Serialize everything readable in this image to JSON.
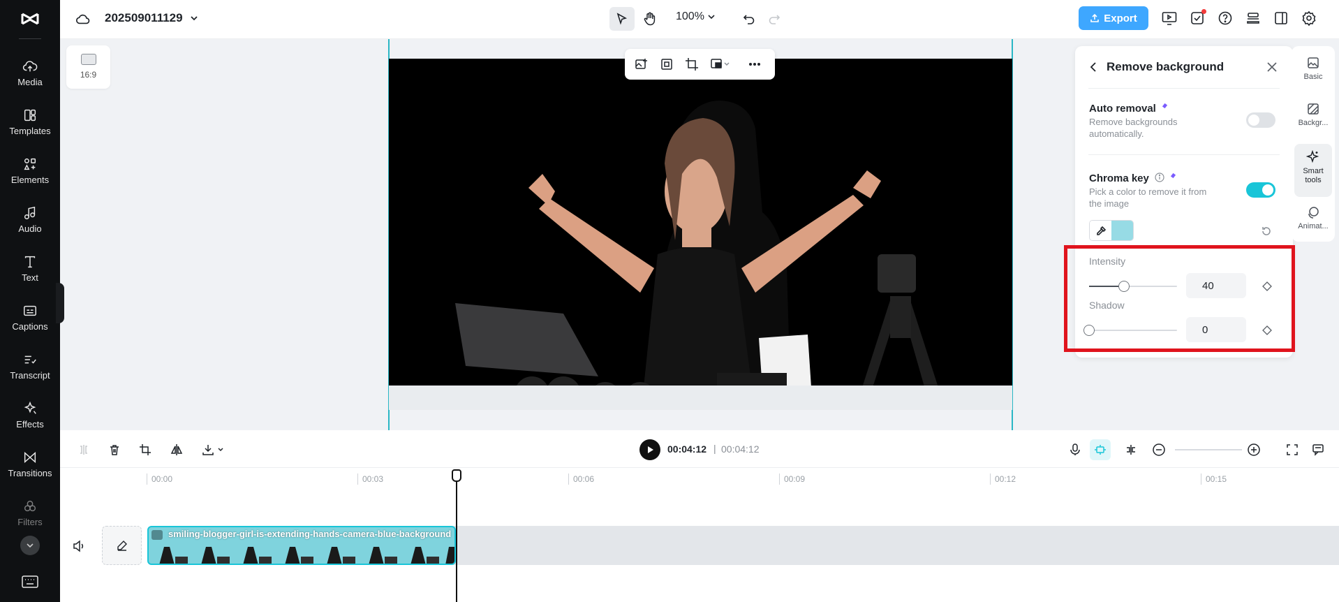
{
  "sidebar": {
    "items": [
      {
        "label": "Media",
        "icon": "upload-cloud-icon"
      },
      {
        "label": "Templates",
        "icon": "templates-icon"
      },
      {
        "label": "Elements",
        "icon": "elements-icon"
      },
      {
        "label": "Audio",
        "icon": "music-note-icon"
      },
      {
        "label": "Text",
        "icon": "text-icon"
      },
      {
        "label": "Captions",
        "icon": "captions-icon"
      },
      {
        "label": "Transcript",
        "icon": "transcript-icon"
      },
      {
        "label": "Effects",
        "icon": "effects-icon"
      },
      {
        "label": "Transitions",
        "icon": "transitions-icon"
      },
      {
        "label": "Filters",
        "icon": "filters-icon"
      }
    ]
  },
  "topbar": {
    "project_name": "202509011129",
    "zoom": "100%",
    "export_label": "Export"
  },
  "canvas": {
    "aspect_ratio": "16:9"
  },
  "panel": {
    "title": "Remove background",
    "auto_removal": {
      "title": "Auto removal",
      "description": "Remove backgrounds automatically.",
      "enabled": false
    },
    "chroma_key": {
      "title": "Chroma key",
      "description": "Pick a color to remove it from the image",
      "enabled": true,
      "picked_color": "#97dbe5"
    },
    "intensity": {
      "label": "Intensity",
      "value": "40",
      "fraction": 0.4
    },
    "shadow": {
      "label": "Shadow",
      "value": "0",
      "fraction": 0
    }
  },
  "tabs": [
    {
      "label": "Basic",
      "icon": "image-icon"
    },
    {
      "label": "Backgr...",
      "icon": "background-icon"
    },
    {
      "label": "Smart tools",
      "icon": "sparkle-icon"
    },
    {
      "label": "Animat...",
      "icon": "animation-icon"
    }
  ],
  "timeline": {
    "current_time": "00:04:12",
    "separator": "|",
    "total_time": "00:04:12",
    "ruler": [
      "00:00",
      "00:03",
      "00:06",
      "00:09",
      "00:12",
      "00:15"
    ],
    "clip_name": "smiling-blogger-girl-is-extending-hands-camera-blue-background"
  },
  "colors": {
    "accent": "#19c5d8",
    "export": "#3ea7ff",
    "highlight": "#e0141d"
  }
}
